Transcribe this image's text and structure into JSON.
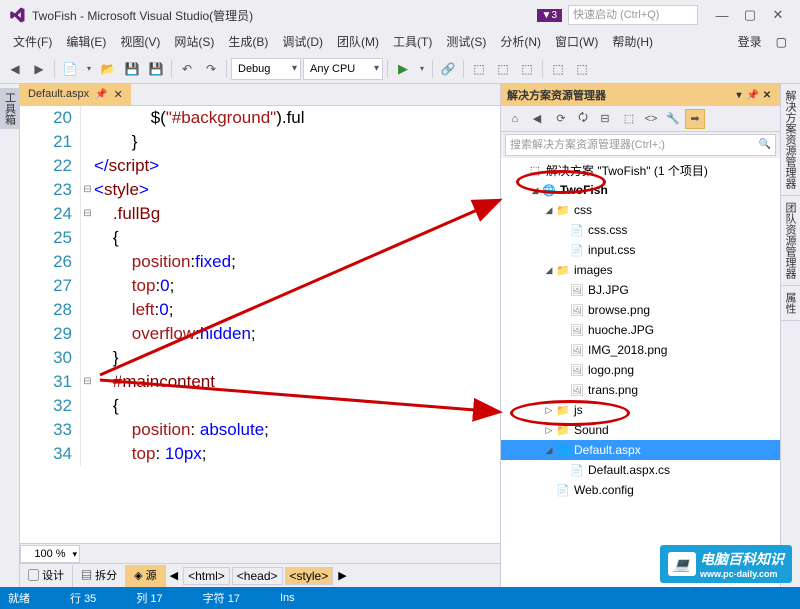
{
  "titlebar": {
    "title": "TwoFish - Microsoft Visual Studio(管理员)",
    "notification_count": "3",
    "quicklaunch_placeholder": "快速启动 (Ctrl+Q)"
  },
  "menubar": {
    "items": [
      "文件(F)",
      "编辑(E)",
      "视图(V)",
      "网站(S)",
      "生成(B)",
      "调试(D)",
      "团队(M)",
      "工具(T)",
      "测试(S)",
      "分析(N)",
      "窗口(W)",
      "帮助(H)"
    ],
    "login": "登录"
  },
  "toolbar": {
    "config": "Debug",
    "platform": "Any CPU"
  },
  "left_tab": "工具箱",
  "tabs": {
    "active": "Default.aspx"
  },
  "code": {
    "lines": [
      {
        "n": 20,
        "html": "            <span class='c-black'>$(</span><span class='c-red'>\"#background\"</span><span class='c-black'>).ful</span>"
      },
      {
        "n": 21,
        "html": "        <span class='c-black'>}</span>"
      },
      {
        "n": 22,
        "html": "<span class='c-blue'>&lt;/</span><span class='c-maroon'>script</span><span class='c-blue'>&gt;</span>"
      },
      {
        "n": 23,
        "html": "<span class='c-blue'>&lt;</span><span class='c-maroon'>style</span><span class='c-blue'>&gt;</span>"
      },
      {
        "n": 24,
        "html": "    <span class='c-maroon'>.fullBg</span>"
      },
      {
        "n": 25,
        "html": "    <span class='c-black'>{</span>"
      },
      {
        "n": 26,
        "html": "        <span class='c-red'>position</span><span class='c-black'>:</span><span class='c-blue'>fixed</span><span class='c-black'>;</span>"
      },
      {
        "n": 27,
        "html": "        <span class='c-red'>top</span><span class='c-black'>:</span><span class='c-blue'>0</span><span class='c-black'>;</span>"
      },
      {
        "n": 28,
        "html": "        <span class='c-red'>left</span><span class='c-black'>:</span><span class='c-blue'>0</span><span class='c-black'>;</span>"
      },
      {
        "n": 29,
        "html": "        <span class='c-red'>overflow</span><span class='c-black'>:</span><span class='c-blue'>hidden</span><span class='c-black'>;</span>"
      },
      {
        "n": 30,
        "html": "    <span class='c-black'>}</span>"
      },
      {
        "n": 31,
        "html": "    <span class='c-maroon'>#maincontent</span>"
      },
      {
        "n": 32,
        "html": "    <span class='c-black'>{</span>"
      },
      {
        "n": 33,
        "html": "        <span class='c-red'>position</span><span class='c-black'>:</span> <span class='c-blue'>absolute</span><span class='c-black'>;</span>"
      },
      {
        "n": 34,
        "html": "        <span class='c-red'>top</span><span class='c-black'>:</span> <span class='c-blue'>10px</span><span class='c-black'>;</span>"
      }
    ]
  },
  "zoom": "100 %",
  "view_tabs": {
    "design": "设计",
    "split": "拆分",
    "source": "源"
  },
  "breadcrumb": [
    "<html>",
    "<head>",
    "<style>"
  ],
  "solution": {
    "title": "解决方案资源管理器",
    "search_placeholder": "搜索解决方案资源管理器(Ctrl+;)",
    "root": "解决方案 \"TwoFish\" (1 个项目)",
    "project": "TwoFish",
    "folders": {
      "css": {
        "label": "css",
        "files": [
          "css.css",
          "input.css"
        ]
      },
      "images": {
        "label": "images",
        "files": [
          "BJ.JPG",
          "browse.png",
          "huoche.JPG",
          "IMG_2018.png",
          "logo.png",
          "trans.png"
        ]
      },
      "js": {
        "label": "js"
      },
      "sound": {
        "label": "Sound"
      }
    },
    "files": {
      "default_aspx": "Default.aspx",
      "default_aspx_cs": "Default.aspx.cs",
      "web_config": "Web.config"
    }
  },
  "right_tabs": [
    "解决方案资源管理器",
    "团队资源管理器",
    "属性"
  ],
  "status": {
    "ready": "就绪",
    "line_label": "行",
    "line": "35",
    "col_label": "列",
    "col": "17",
    "char_label": "字符",
    "char": "17",
    "ins": "Ins"
  },
  "watermark": {
    "text": "电脑百科知识",
    "url": "www.pc-daily.com"
  }
}
